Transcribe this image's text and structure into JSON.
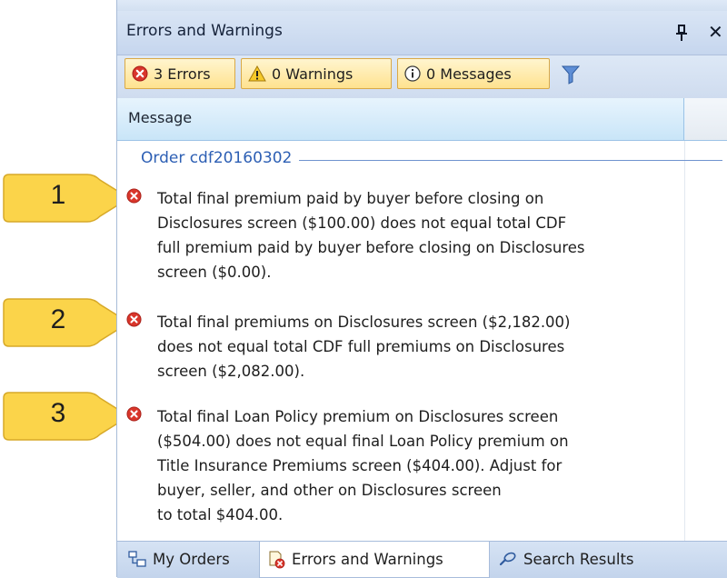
{
  "panel": {
    "title": "Errors and Warnings",
    "pin_icon": "pin-icon",
    "close_glyph": "✕"
  },
  "toolbar": {
    "errors_label": "3 Errors",
    "warnings_label": "0 Warnings",
    "messages_label": "0 Messages",
    "filter_icon": "funnel-icon"
  },
  "grid": {
    "header_message": "Message",
    "group_label": "Order cdf20160302",
    "items": [
      {
        "number": "1",
        "text": "Total final premium paid by buyer before closing on\nDisclosures screen ($100.00) does not equal total CDF\nfull premium paid by buyer before closing on Disclosures\nscreen ($0.00)."
      },
      {
        "number": "2",
        "text": "Total final premiums on Disclosures screen ($2,182.00)\ndoes not equal total CDF full premiums on Disclosures\nscreen ($2,082.00)."
      },
      {
        "number": "3",
        "text": "Total final Loan Policy premium on Disclosures screen\n($504.00) does not equal final Loan Policy premium on\nTitle Insurance Premiums screen ($404.00).  Adjust for\nbuyer, seller, and other on Disclosures screen\nto total $404.00."
      }
    ]
  },
  "bottom_tabs": {
    "my_orders": "My Orders",
    "errors_and_warnings": "Errors and Warnings",
    "search_results": "Search Results"
  },
  "colors": {
    "callout_fill": "#fbd44a",
    "error_red": "#d9362b",
    "accent_blue": "#2d5fb4"
  }
}
